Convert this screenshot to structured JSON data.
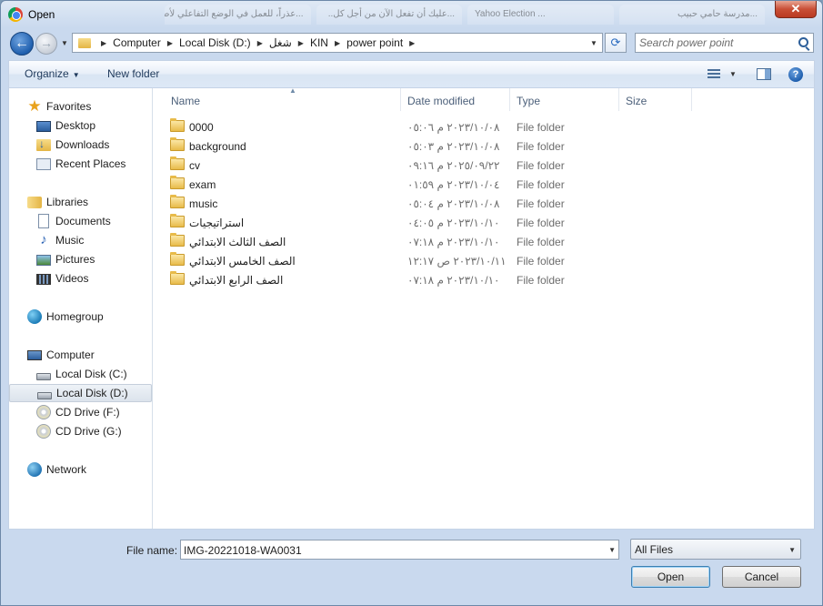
{
  "window": {
    "title": "Open",
    "close_glyph": "✕"
  },
  "background_tabs": [
    "...عذراً، للعمل في الوضع التفاعلي لأصحاب...",
    "...عليك أن تفعل الآن من أجل كل..",
    "Yahoo Election ...",
    "...مدرسة حامي حبيب"
  ],
  "address": {
    "crumbs": [
      "Computer",
      "Local Disk (D:)",
      "شغل",
      "KIN",
      "power point"
    ],
    "separator": "▶",
    "dropdown": "▼"
  },
  "search": {
    "placeholder": "Search power point"
  },
  "toolbar": {
    "organize_label": "Organize",
    "organize_caret": "▼",
    "new_folder_label": "New folder",
    "view_caret": "▼",
    "help_glyph": "?"
  },
  "nav_glyphs": {
    "back": "←",
    "forward": "→",
    "history": "▼",
    "refresh": "⟳",
    "favorites_star": "★",
    "music_note": "♪"
  },
  "navigation": {
    "favorites": {
      "label": "Favorites",
      "items": [
        "Desktop",
        "Downloads",
        "Recent Places"
      ]
    },
    "libraries": {
      "label": "Libraries",
      "items": [
        "Documents",
        "Music",
        "Pictures",
        "Videos"
      ]
    },
    "homegroup": {
      "label": "Homegroup"
    },
    "computer": {
      "label": "Computer",
      "items": [
        "Local Disk (C:)",
        "Local Disk (D:)",
        "CD Drive (F:)",
        "CD Drive (G:)"
      ]
    },
    "network": {
      "label": "Network"
    }
  },
  "columns": {
    "name": "Name",
    "date": "Date modified",
    "type": "Type",
    "size": "Size",
    "sort_glyph": "▲"
  },
  "files": [
    {
      "name": "0000",
      "date": "٢٠٢٣/١٠/٠٨ م ٠٥:٠٦",
      "type": "File folder"
    },
    {
      "name": "background",
      "date": "٢٠٢٣/١٠/٠٨ م ٠٥:٠٣",
      "type": "File folder"
    },
    {
      "name": "cv",
      "date": "٢٠٢٥/٠٩/٢٢ م ٠٩:١٦",
      "type": "File folder"
    },
    {
      "name": "exam",
      "date": "٢٠٢٣/١٠/٠٤ م ٠١:٥٩",
      "type": "File folder"
    },
    {
      "name": "music",
      "date": "٢٠٢٣/١٠/٠٨ م ٠٥:٠٤",
      "type": "File folder"
    },
    {
      "name": "استراتيجيات",
      "date": "٢٠٢٣/١٠/١٠ م ٠٤:٠٥",
      "type": "File folder"
    },
    {
      "name": "الصف الثالث الابتدائي",
      "date": "٢٠٢٣/١٠/١٠ م ٠٧:١٨",
      "type": "File folder"
    },
    {
      "name": "الصف الخامس الابتدائي",
      "date": "٢٠٢٣/١٠/١١ ص ١٢:١٧",
      "type": "File folder"
    },
    {
      "name": "الصف الرابع الابتدائي",
      "date": "٢٠٢٣/١٠/١٠ م ٠٧:١٨",
      "type": "File folder"
    }
  ],
  "footer": {
    "file_name_label": "File name:",
    "file_name_value": "IMG-20221018-WA0031",
    "file_type_value": "All Files",
    "open_label": "Open",
    "cancel_label": "Cancel",
    "dropdown": "▼"
  }
}
